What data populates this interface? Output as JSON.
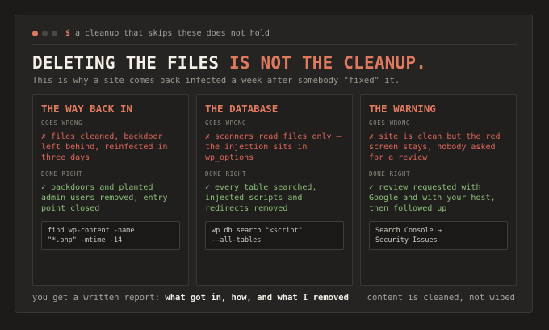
{
  "window": {
    "dots": [
      "#e07a5f",
      "#4a4845",
      "#4a4845"
    ],
    "prompt": "$",
    "command": "a cleanup that skips these does not hold"
  },
  "headline": {
    "lead": "DELETING THE FILES ",
    "accent": "IS NOT THE CLEANUP."
  },
  "subline": "This is why a site comes back infected a week after somebody \"fixed\" it.",
  "cards": [
    {
      "title": "THE WAY BACK IN",
      "wrong_label": "GOES WRONG",
      "wrong": "✗ files cleaned, backdoor left behind, reinfected in three days",
      "right_label": "DONE RIGHT",
      "right": "✓ backdoors and planted admin users removed, entry point closed",
      "code": "find wp-content -name\n\"*.php\" -mtime -14"
    },
    {
      "title": "THE DATABASE",
      "wrong_label": "GOES WRONG",
      "wrong": "✗ scanners read files only — the injection sits in wp_options",
      "right_label": "DONE RIGHT",
      "right": "✓ every table searched, injected scripts and redirects removed",
      "code": "wp db search \"<script\"\n--all-tables"
    },
    {
      "title": "THE WARNING",
      "wrong_label": "GOES WRONG",
      "wrong": "✗ site is clean but the red screen stays, nobody asked for a review",
      "right_label": "DONE RIGHT",
      "right": "✓ review requested with Google and with your host, then followed up",
      "code": "Search Console →\nSecurity Issues"
    }
  ],
  "footer": {
    "left_prefix": "you get a written report: ",
    "left_bold": "what got in, how, and what I removed",
    "right": "content is cleaned, not wiped"
  },
  "colors": {
    "accent": "#e07a5f",
    "wrong": "#e0675c",
    "right": "#8cc07a"
  }
}
